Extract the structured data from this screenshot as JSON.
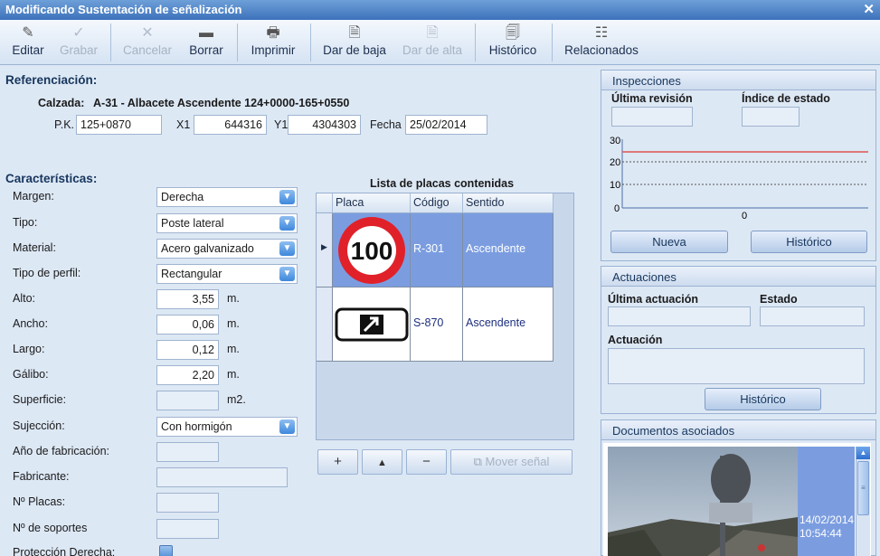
{
  "window": {
    "title": "Modificando Sustentación de señalización",
    "close": "✕"
  },
  "toolbar": {
    "editar": "Editar",
    "grabar": "Grabar",
    "cancelar": "Cancelar",
    "borrar": "Borrar",
    "imprimir": "Imprimir",
    "dar_baja": "Dar de baja",
    "dar_alta": "Dar de alta",
    "historico": "Histórico",
    "relacionados": "Relacionados"
  },
  "referenciacion": {
    "title": "Referenciación:",
    "calzada_label": "Calzada:",
    "calzada_value": "A-31 - Albacete Ascendente 124+0000-165+0550",
    "pk_label": "P.K.",
    "pk_value": "125+0870",
    "x1_label": "X1",
    "x1_value": "644316",
    "y1_label": "Y1",
    "y1_value": "4304303",
    "fecha_label": "Fecha",
    "fecha_value": "25/02/2014"
  },
  "caracteristicas": {
    "title": "Características:",
    "margen_label": "Margen:",
    "margen_value": "Derecha",
    "tipo_label": "Tipo:",
    "tipo_value": "Poste lateral",
    "material_label": "Material:",
    "material_value": "Acero galvanizado",
    "perfil_label": "Tipo de perfil:",
    "perfil_value": "Rectangular",
    "alto_label": "Alto:",
    "alto_value": "3,55",
    "alto_unit": "m.",
    "ancho_label": "Ancho:",
    "ancho_value": "0,06",
    "ancho_unit": "m.",
    "largo_label": "Largo:",
    "largo_value": "0,12",
    "largo_unit": "m.",
    "galibo_label": "Gálibo:",
    "galibo_value": "2,20",
    "galibo_unit": "m.",
    "superficie_label": "Superficie:",
    "superficie_value": "",
    "superficie_unit": "m2.",
    "sujecion_label": "Sujección:",
    "sujecion_value": "Con hormigón",
    "anio_label": "Año de fabricación:",
    "anio_value": "",
    "fabricante_label": "Fabricante:",
    "fabricante_value": "",
    "nplacas_label": "Nº Placas:",
    "nplacas_value": "",
    "nsoportes_label": "Nº de soportes",
    "nsoportes_value": "",
    "proteccion_label": "Protección Derecha:"
  },
  "placas": {
    "title": "Lista de placas contenidas",
    "col_placa": "Placa",
    "col_codigo": "Código",
    "col_sentido": "Sentido",
    "rows": [
      {
        "sign": "100",
        "codigo": "R-301",
        "sentido": "Ascendente"
      },
      {
        "sign": "arrow",
        "codigo": "S-870",
        "sentido": "Ascendente"
      }
    ],
    "mover_label": "Mover señal"
  },
  "inspecciones": {
    "title": "Inspecciones",
    "ultima_revision_label": "Última revisión",
    "indice_label": "Índice de estado",
    "chart_ticks": [
      "30",
      "20",
      "10",
      "0"
    ],
    "chart_x_tick": "0",
    "nueva_label": "Nueva",
    "historico_label": "Histórico"
  },
  "actuaciones": {
    "title": "Actuaciones",
    "ultima_label": "Última actuación",
    "estado_label": "Estado",
    "actuacion_label": "Actuación",
    "historico_label": "Histórico"
  },
  "documentos": {
    "title": "Documentos asociados",
    "photo_date": "14/02/2014",
    "photo_time": "10:54:44"
  },
  "colors": {
    "accent": "#3d72bb",
    "selected_row": "#7b9de0",
    "sign_red": "#e0212a"
  }
}
